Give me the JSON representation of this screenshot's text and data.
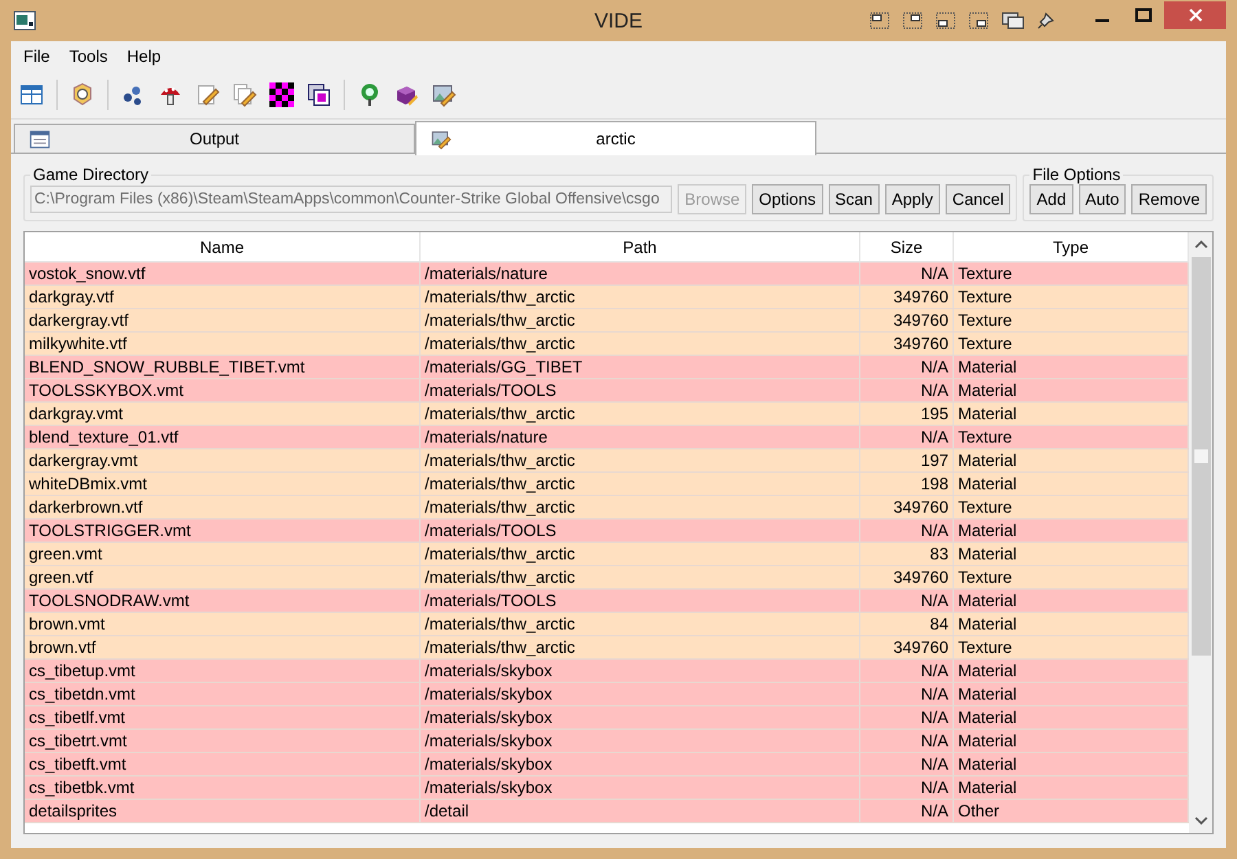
{
  "window": {
    "title": "VIDE"
  },
  "menu": [
    "File",
    "Tools",
    "Help"
  ],
  "tabs": [
    {
      "label": "Output",
      "selected": false,
      "kind": "list"
    },
    {
      "label": "arctic",
      "selected": true,
      "kind": "picture"
    }
  ],
  "game_directory": {
    "title": "Game Directory",
    "value": "C:\\Program Files (x86)\\Steam\\SteamApps\\common\\Counter-Strike Global Offensive\\csgo",
    "buttons": [
      {
        "label": "Browse",
        "disabled": true
      },
      {
        "label": "Options",
        "disabled": false
      },
      {
        "label": "Scan",
        "disabled": false
      },
      {
        "label": "Apply",
        "disabled": false
      },
      {
        "label": "Cancel",
        "disabled": false
      }
    ]
  },
  "file_options": {
    "title": "File Options",
    "buttons": [
      "Add",
      "Auto",
      "Remove"
    ]
  },
  "table": {
    "columns": [
      "Name",
      "Path",
      "Size",
      "Type"
    ],
    "rows": [
      {
        "name": "vostok_snow.vtf",
        "path": "/materials/nature",
        "size": "N/A",
        "type": "Texture",
        "color": "#ffc0c0"
      },
      {
        "name": "darkgray.vtf",
        "path": "/materials/thw_arctic",
        "size": "349760",
        "type": "Texture",
        "color": "#ffe0c0"
      },
      {
        "name": "darkergray.vtf",
        "path": "/materials/thw_arctic",
        "size": "349760",
        "type": "Texture",
        "color": "#ffe0c0"
      },
      {
        "name": "milkywhite.vtf",
        "path": "/materials/thw_arctic",
        "size": "349760",
        "type": "Texture",
        "color": "#ffe0c0"
      },
      {
        "name": "BLEND_SNOW_RUBBLE_TIBET.vmt",
        "path": "/materials/GG_TIBET",
        "size": "N/A",
        "type": "Material",
        "color": "#ffc0c0"
      },
      {
        "name": "TOOLSSKYBOX.vmt",
        "path": "/materials/TOOLS",
        "size": "N/A",
        "type": "Material",
        "color": "#ffc0c0"
      },
      {
        "name": "darkgray.vmt",
        "path": "/materials/thw_arctic",
        "size": "195",
        "type": "Material",
        "color": "#ffe0c0"
      },
      {
        "name": "blend_texture_01.vtf",
        "path": "/materials/nature",
        "size": "N/A",
        "type": "Texture",
        "color": "#ffc0c0"
      },
      {
        "name": "darkergray.vmt",
        "path": "/materials/thw_arctic",
        "size": "197",
        "type": "Material",
        "color": "#ffe0c0"
      },
      {
        "name": "whiteDBmix.vmt",
        "path": "/materials/thw_arctic",
        "size": "198",
        "type": "Material",
        "color": "#ffe0c0"
      },
      {
        "name": "darkerbrown.vtf",
        "path": "/materials/thw_arctic",
        "size": "349760",
        "type": "Texture",
        "color": "#ffe0c0"
      },
      {
        "name": "TOOLSTRIGGER.vmt",
        "path": "/materials/TOOLS",
        "size": "N/A",
        "type": "Material",
        "color": "#ffc0c0"
      },
      {
        "name": "green.vmt",
        "path": "/materials/thw_arctic",
        "size": "83",
        "type": "Material",
        "color": "#ffe0c0"
      },
      {
        "name": "green.vtf",
        "path": "/materials/thw_arctic",
        "size": "349760",
        "type": "Texture",
        "color": "#ffe0c0"
      },
      {
        "name": "TOOLSNODRAW.vmt",
        "path": "/materials/TOOLS",
        "size": "N/A",
        "type": "Material",
        "color": "#ffc0c0"
      },
      {
        "name": "brown.vmt",
        "path": "/materials/thw_arctic",
        "size": "84",
        "type": "Material",
        "color": "#ffe0c0"
      },
      {
        "name": "brown.vtf",
        "path": "/materials/thw_arctic",
        "size": "349760",
        "type": "Texture",
        "color": "#ffe0c0"
      },
      {
        "name": "cs_tibetup.vmt",
        "path": "/materials/skybox",
        "size": "N/A",
        "type": "Material",
        "color": "#ffc0c0"
      },
      {
        "name": "cs_tibetdn.vmt",
        "path": "/materials/skybox",
        "size": "N/A",
        "type": "Material",
        "color": "#ffc0c0"
      },
      {
        "name": "cs_tibetlf.vmt",
        "path": "/materials/skybox",
        "size": "N/A",
        "type": "Material",
        "color": "#ffc0c0"
      },
      {
        "name": "cs_tibetrt.vmt",
        "path": "/materials/skybox",
        "size": "N/A",
        "type": "Material",
        "color": "#ffc0c0"
      },
      {
        "name": "cs_tibetft.vmt",
        "path": "/materials/skybox",
        "size": "N/A",
        "type": "Material",
        "color": "#ffc0c0"
      },
      {
        "name": "cs_tibetbk.vmt",
        "path": "/materials/skybox",
        "size": "N/A",
        "type": "Material",
        "color": "#ffc0c0"
      },
      {
        "name": "detailsprites",
        "path": "/detail",
        "size": "N/A",
        "type": "Other",
        "color": "#ffc0c0"
      }
    ]
  }
}
